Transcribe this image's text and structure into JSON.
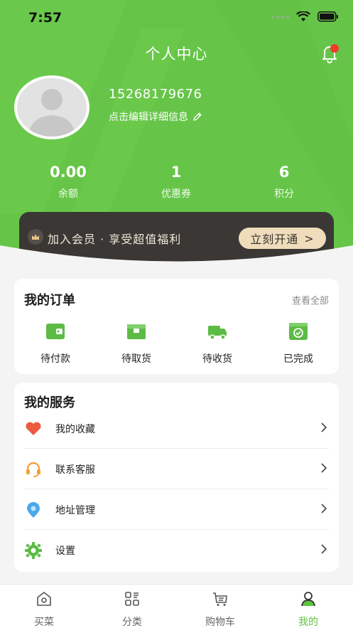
{
  "status_bar": {
    "time": "7:57"
  },
  "header": {
    "title": "个人中心"
  },
  "profile": {
    "phone": "15268179676",
    "edit_text": "点击编辑详细信息"
  },
  "stats": [
    {
      "value": "0.00",
      "label": "余额"
    },
    {
      "value": "1",
      "label": "优惠券"
    },
    {
      "value": "6",
      "label": "积分"
    }
  ],
  "vip": {
    "text": "加入会员 · 享受超值福利",
    "button": "立刻开通",
    "button_arrow": ">"
  },
  "orders": {
    "title": "我的订单",
    "view_all": "查看全部",
    "items": [
      {
        "label": "待付款",
        "icon": "wallet-icon"
      },
      {
        "label": "待取货",
        "icon": "package-icon"
      },
      {
        "label": "待收货",
        "icon": "truck-icon"
      },
      {
        "label": "已完成",
        "icon": "check-card-icon"
      }
    ]
  },
  "services": {
    "title": "我的服务",
    "items": [
      {
        "label": "我的收藏",
        "icon": "heart-icon"
      },
      {
        "label": "联系客服",
        "icon": "headset-icon"
      },
      {
        "label": "地址管理",
        "icon": "location-pin-icon"
      },
      {
        "label": "设置",
        "icon": "gear-icon"
      }
    ]
  },
  "tabbar": [
    {
      "label": "买菜",
      "icon": "home-icon"
    },
    {
      "label": "分类",
      "icon": "category-icon"
    },
    {
      "label": "购物车",
      "icon": "cart-icon"
    },
    {
      "label": "我的",
      "icon": "user-icon",
      "active": true
    }
  ],
  "colors": {
    "primary": "#66c548",
    "active_tab": "#5cc33e",
    "vip_bg": "#3a3735",
    "vip_button": "#eedcbb"
  }
}
